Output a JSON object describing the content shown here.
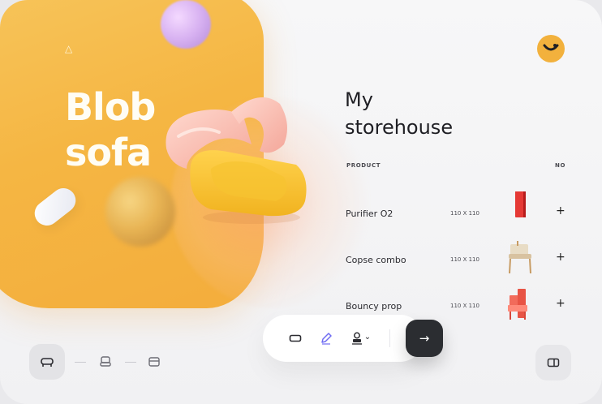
{
  "hero": {
    "title_line1": "Blob",
    "title_line2": "sofa",
    "logo_glyph": "△"
  },
  "storehouse": {
    "title_line1": "My",
    "title_line2": "storehouse",
    "header_product": "PRODUCT",
    "header_no": "NO"
  },
  "products": [
    {
      "name": "Purifier O2",
      "size": "110 X 110",
      "add": "+",
      "thumb_icon": "red-purifier-icon"
    },
    {
      "name": "Copse combo",
      "size": "110 X 110",
      "add": "+",
      "thumb_icon": "wooden-chair-icon"
    },
    {
      "name": "Bouncy prop",
      "size": "110 X 110",
      "add": "+",
      "thumb_icon": "red-chair-icon"
    }
  ],
  "toolbar": {
    "go_label": "→",
    "dropdown_caret": "⌄"
  },
  "colors": {
    "accent_yellow": "#f5b643",
    "dark_button": "#2b2d31",
    "pen_icon": "#6f6cf2",
    "product_red": "#e53935"
  }
}
